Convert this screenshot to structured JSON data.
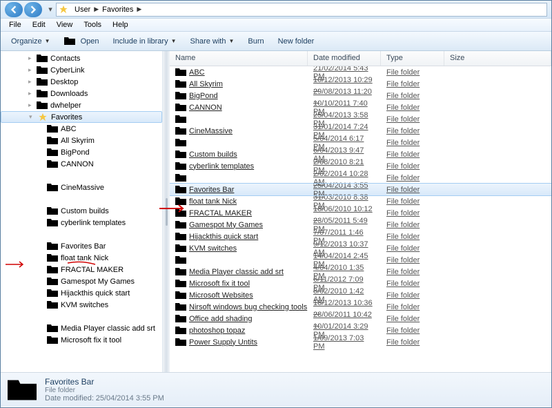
{
  "address": {
    "parts": [
      "User",
      "Favorites"
    ]
  },
  "menu": [
    "File",
    "Edit",
    "View",
    "Tools",
    "Help"
  ],
  "toolbar": {
    "organize": "Organize",
    "open": "Open",
    "include": "Include in library",
    "share": "Share with",
    "burn": "Burn",
    "newfolder": "New folder"
  },
  "tree": [
    {
      "label": "Contacts",
      "depth": 2,
      "icon": "contacts"
    },
    {
      "label": "CyberLink",
      "depth": 2,
      "icon": "folder"
    },
    {
      "label": "Desktop",
      "depth": 2,
      "icon": "desktop"
    },
    {
      "label": "Downloads",
      "depth": 2,
      "icon": "downloads"
    },
    {
      "label": "dwhelper",
      "depth": 2,
      "icon": "folder"
    },
    {
      "label": "Favorites",
      "depth": 2,
      "icon": "favorites",
      "selected": true,
      "expanded": true
    },
    {
      "label": "ABC",
      "depth": 3,
      "icon": "folder"
    },
    {
      "label": "All Skyrim",
      "depth": 3,
      "icon": "folder"
    },
    {
      "label": "BigPond",
      "depth": 3,
      "icon": "folder"
    },
    {
      "label": "CANNON",
      "depth": 3,
      "icon": "folder"
    },
    {
      "label": "",
      "depth": 3,
      "icon": "blank"
    },
    {
      "label": "CineMassive",
      "depth": 3,
      "icon": "folder"
    },
    {
      "label": "",
      "depth": 3,
      "icon": "blank"
    },
    {
      "label": "Custom builds",
      "depth": 3,
      "icon": "folder"
    },
    {
      "label": "cyberlink templates",
      "depth": 3,
      "icon": "folder"
    },
    {
      "label": "",
      "depth": 3,
      "icon": "blank"
    },
    {
      "label": "Favorites Bar",
      "depth": 3,
      "icon": "folder",
      "annotated": true
    },
    {
      "label": "float tank Nick",
      "depth": 3,
      "icon": "folder"
    },
    {
      "label": "FRACTAL MAKER",
      "depth": 3,
      "icon": "folder"
    },
    {
      "label": "Gamespot My Games",
      "depth": 3,
      "icon": "folder"
    },
    {
      "label": "Hijackthis quick start",
      "depth": 3,
      "icon": "folder"
    },
    {
      "label": "KVM switches",
      "depth": 3,
      "icon": "folder"
    },
    {
      "label": "",
      "depth": 3,
      "icon": "blank"
    },
    {
      "label": "Media Player classic add srt",
      "depth": 3,
      "icon": "folder"
    },
    {
      "label": "Microsoft fix it tool",
      "depth": 3,
      "icon": "folder"
    }
  ],
  "columns": {
    "name": "Name",
    "date": "Date modified",
    "type": "Type",
    "size": "Size"
  },
  "rows": [
    {
      "name": "ABC",
      "date": "21/02/2014 5:43 PM",
      "type": "File folder"
    },
    {
      "name": "All Skyrim",
      "date": "10/12/2013 10:29 ...",
      "type": "File folder"
    },
    {
      "name": "BigPond",
      "date": "29/08/2013 11:20 ...",
      "type": "File folder"
    },
    {
      "name": "CANNON",
      "date": "10/10/2011 7:40 PM",
      "type": "File folder"
    },
    {
      "name": "",
      "date": "25/04/2013 3:58 PM",
      "type": "File folder"
    },
    {
      "name": "CineMassive",
      "date": "31/01/2014 7:24 PM",
      "type": "File folder"
    },
    {
      "name": "",
      "date": "5/04/2014 6:17 PM",
      "type": "File folder"
    },
    {
      "name": "Custom builds",
      "date": "6/04/2013 9:47 AM",
      "type": "File folder"
    },
    {
      "name": "cyberlink templates",
      "date": "2/08/2010 8:21 PM",
      "type": "File folder"
    },
    {
      "name": "",
      "date": "2/02/2014 10:28 AM",
      "type": "File folder"
    },
    {
      "name": "Favorites Bar",
      "date": "25/04/2014 3:55 PM",
      "type": "File folder",
      "selected": true,
      "annotated": true
    },
    {
      "name": "float tank Nick",
      "date": "31/03/2010 8:38 PM",
      "type": "File folder"
    },
    {
      "name": "FRACTAL MAKER",
      "date": "18/06/2010 10:12 ...",
      "type": "File folder"
    },
    {
      "name": "Gamespot My Games",
      "date": "23/05/2011 5:49 PM",
      "type": "File folder"
    },
    {
      "name": "Hijackthis quick start",
      "date": "7/07/2011 1:46 PM",
      "type": "File folder"
    },
    {
      "name": "KVM switches",
      "date": "9/12/2013 10:37 AM",
      "type": "File folder"
    },
    {
      "name": "",
      "date": "14/04/2014 2:45 PM",
      "type": "File folder"
    },
    {
      "name": "Media Player classic add srt",
      "date": "4/04/2010 1:35 PM",
      "type": "File folder"
    },
    {
      "name": "Microsoft fix it tool",
      "date": "6/11/2012 7:09 PM",
      "type": "File folder"
    },
    {
      "name": "Microsoft Websites",
      "date": "8/02/2010 1:42 AM",
      "type": "File folder"
    },
    {
      "name": "Nirsoft windows bug checking tools",
      "date": "18/12/2013 10:36 ...",
      "type": "File folder"
    },
    {
      "name": "Office add shading",
      "date": "28/06/2011 10:42 ...",
      "type": "File folder"
    },
    {
      "name": "photoshop topaz",
      "date": "10/01/2014 3:29 PM",
      "type": "File folder"
    },
    {
      "name": "Power Supply Untits",
      "date": "1/09/2013 7:03 PM",
      "type": "File folder"
    }
  ],
  "details": {
    "title": "Favorites Bar",
    "type": "File folder",
    "modlabel": "Date modified:",
    "modval": "25/04/2014 3:55 PM"
  }
}
